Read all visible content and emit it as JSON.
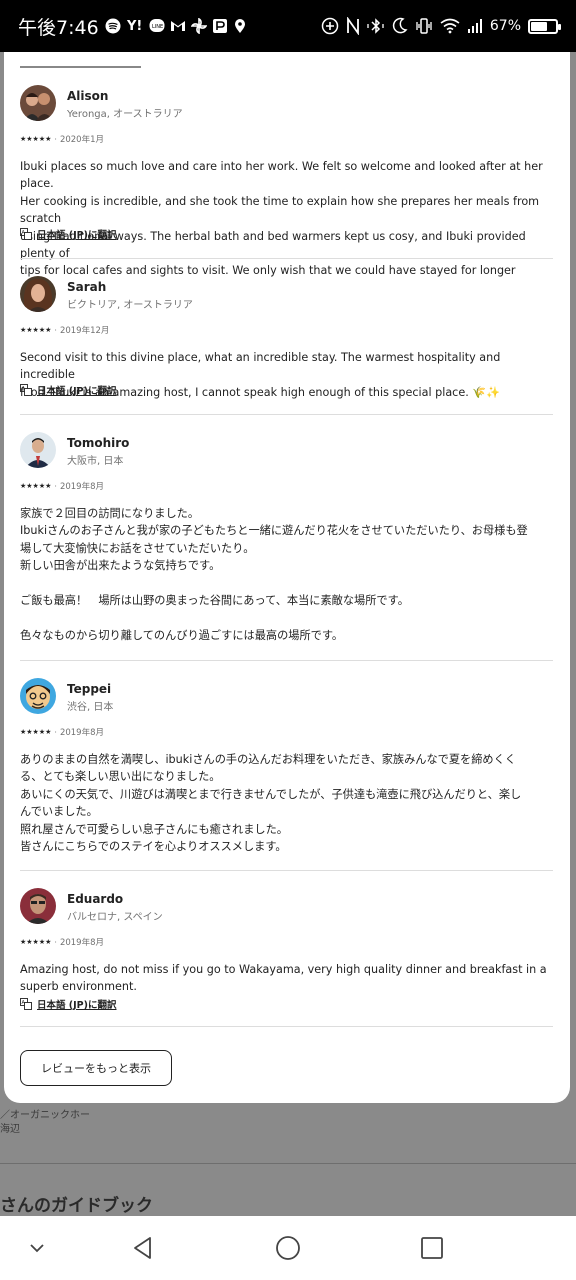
{
  "status_bar": {
    "time": "午後7:46",
    "battery": "67%",
    "battery_level": 0.67
  },
  "background": {
    "text_line_1": "／オーガニックホー",
    "text_line_2": "海辺",
    "heading": "さんのガイドブック"
  },
  "reviews": [
    {
      "name": "Alison",
      "location": "Yeronga, オーストラリア",
      "stars": "★★★★★",
      "date": "2020年1月",
      "text": "Ibuki places so much love and care into her work. We felt so welcome and looked after at her place.\nHer cooking is incredible, and she took the time to explain how she prepares her meals from scratch\nusing traditional ways. The herbal bath and bed warmers kept us cosy, and Ibuki provided plenty of\ntips for local cafes and sights to visit. We only wish that we could have stayed for longer",
      "translate": "日本語 (JP)に翻訳"
    },
    {
      "name": "Sarah",
      "location": "ビクトリア, オーストラリア",
      "stars": "★★★★★",
      "date": "2019年12月",
      "text": "Second visit to this divine place, what an incredible stay. The warmest hospitality and incredible\nfood. Ibuki is an amazing host, I cannot speak high enough of this special place. 🌾✨",
      "translate": "日本語 (JP)に翻訳"
    },
    {
      "name": "Tomohiro",
      "location": "大阪市, 日本",
      "stars": "★★★★★",
      "date": "2019年8月",
      "text": "家族で２回目の訪問になりました。\nIbukiさんのお子さんと我が家の子どもたちと一緒に遊んだり花火をさせていただいたり、お母様も登\n場して大変愉快にお話をさせていただいたり。\n新しい田舎が出来たような気持ちです。\n\nご飯も最高！　場所は山野の奥まった谷間にあって、本当に素敵な場所です。\n\n色々なものから切り離してのんびり過ごすには最高の場所です。"
    },
    {
      "name": "Teppei",
      "location": "渋谷, 日本",
      "stars": "★★★★★",
      "date": "2019年8月",
      "text": "ありのままの自然を満喫し、ibukiさんの手の込んだお料理をいただき、家族みんなで夏を締めくく\nる、とても楽しい思い出になりました。\nあいにくの天気で、川遊びは満喫とまで行きませんでしたが、子供達も滝壺に飛び込んだりと、楽し\nんでいました。\n照れ屋さんで可愛らしい息子さんにも癒されました。\n皆さんにこちらでのステイを心よりオススメします。"
    },
    {
      "name": "Eduardo",
      "location": "バルセロナ, スペイン",
      "stars": "★★★★★",
      "date": "2019年8月",
      "text": "Amazing host, do not miss if you go to Wakayama, very high quality dinner and breakfast in a\nsuperb environment.",
      "translate": "日本語 (JP)に翻訳"
    }
  ],
  "show_more_button": "レビューをもっと表示",
  "icons": {
    "translate": "translate-icon",
    "back": "back-triangle-icon",
    "home": "home-circle-icon",
    "recents": "recents-square-icon",
    "collapse": "chevron-down-icon"
  }
}
